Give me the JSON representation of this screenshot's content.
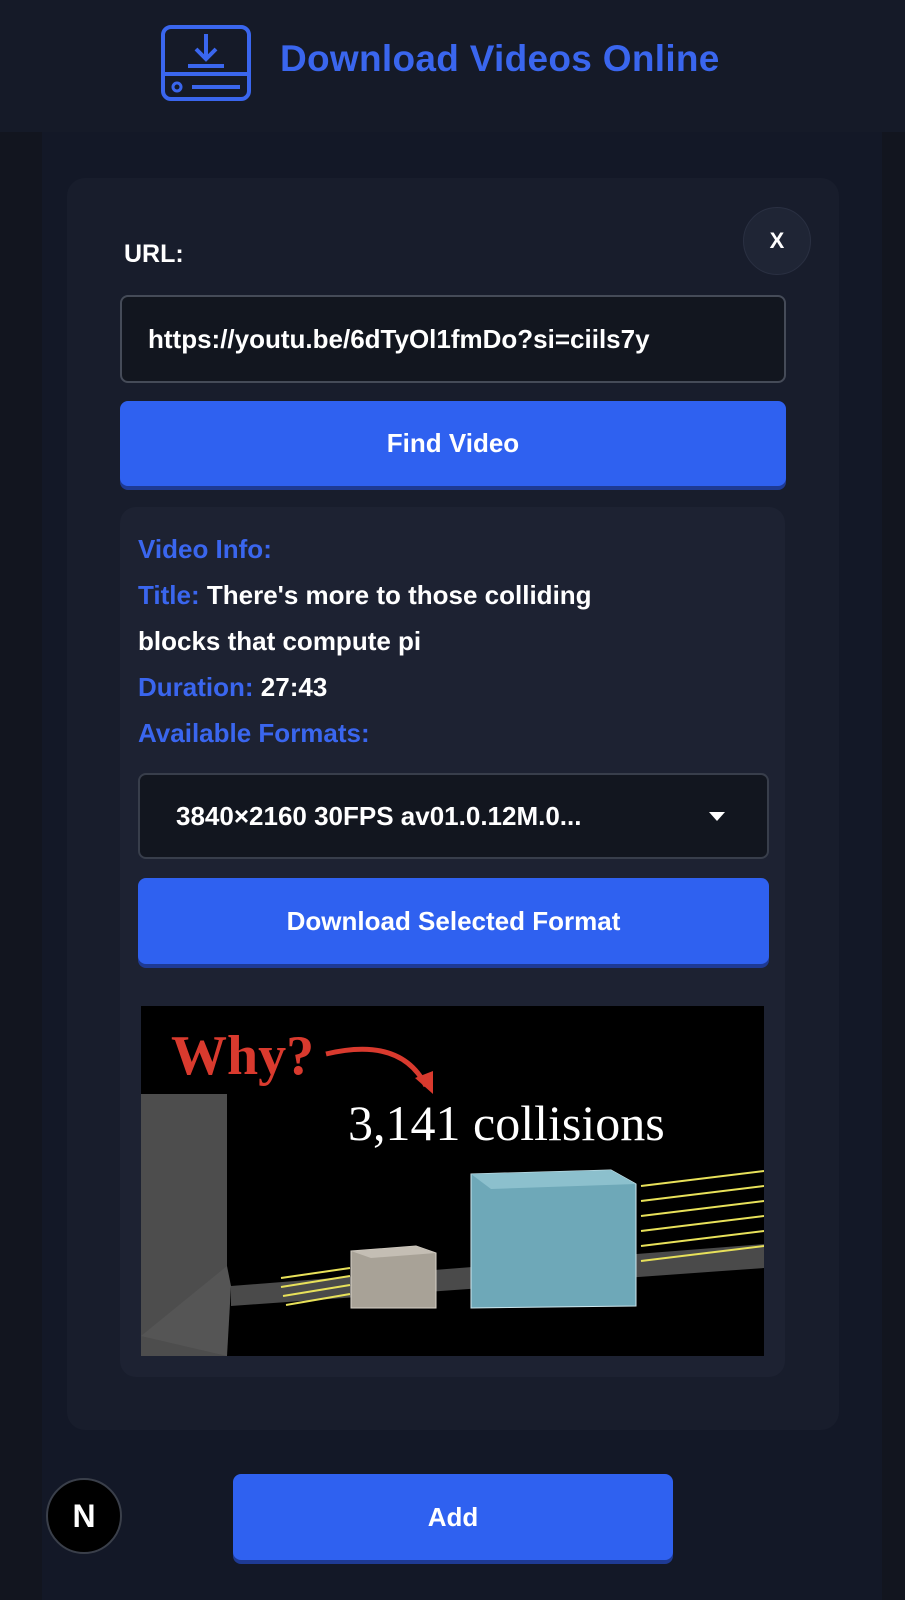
{
  "header": {
    "title": "Download Videos Online",
    "logo_icon": "download-box-icon",
    "accent_color": "#3a66ee"
  },
  "form": {
    "close_label": "X",
    "url_label": "URL:",
    "url_value": "https://youtu.be/6dTyOl1fmDo?si=ciils7y",
    "find_button": "Find Video"
  },
  "video_info": {
    "heading": "Video Info:",
    "title_label": "Title:",
    "title_value_line1": "There's more to those colliding",
    "title_value_line2": "blocks that compute pi",
    "duration_label": "Duration:",
    "duration_value": "27:43",
    "formats_label": "Available Formats:",
    "selected_format": "3840×2160 30FPS av01.0.12M.0...",
    "download_button": "Download Selected Format"
  },
  "thumbnail": {
    "why_text": "Why?",
    "collisions_text": "3,141  collisions"
  },
  "footer": {
    "add_button": "Add",
    "badge_letter": "N"
  }
}
